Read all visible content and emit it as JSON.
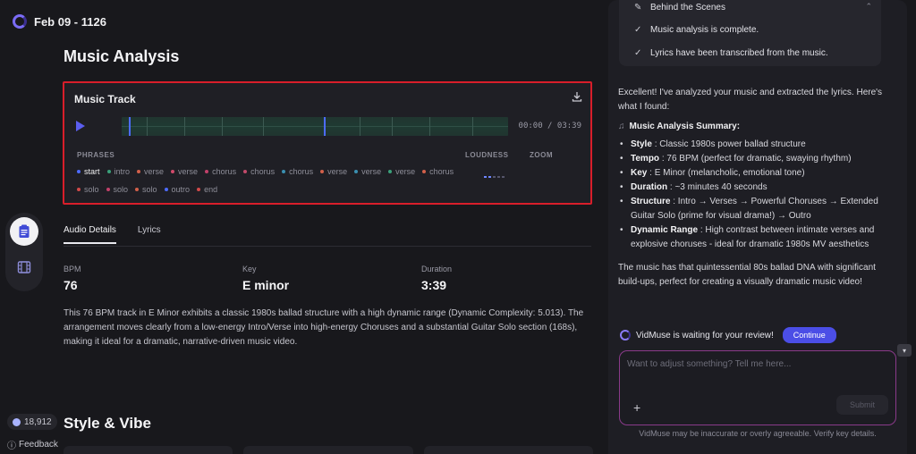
{
  "header": {
    "title": "Feb 09 - 1126"
  },
  "rail": {
    "credits": "18,912",
    "feedback": "Feedback"
  },
  "main": {
    "title": "Music Analysis",
    "track": {
      "title": "Music Track",
      "time": "00:00 / 03:39",
      "labels": {
        "phrases": "PHRASES",
        "loudness": "LOUDNESS",
        "zoom": "ZOOM"
      },
      "phrases": [
        {
          "name": "start",
          "color": "#4d6bff"
        },
        {
          "name": "intro",
          "color": "#3aa07a"
        },
        {
          "name": "verse",
          "color": "#d2604a"
        },
        {
          "name": "verse",
          "color": "#d14a6a"
        },
        {
          "name": "chorus",
          "color": "#c2416a"
        },
        {
          "name": "chorus",
          "color": "#c24a6a"
        },
        {
          "name": "chorus",
          "color": "#3a8fb0"
        },
        {
          "name": "verse",
          "color": "#d2604a"
        },
        {
          "name": "verse",
          "color": "#3a8fb0"
        },
        {
          "name": "verse",
          "color": "#3aa07a"
        },
        {
          "name": "chorus",
          "color": "#d2604a"
        },
        {
          "name": "solo",
          "color": "#d14a4a"
        },
        {
          "name": "solo",
          "color": "#c2416a"
        },
        {
          "name": "solo",
          "color": "#d2604a"
        },
        {
          "name": "outro",
          "color": "#4d6bff"
        },
        {
          "name": "end",
          "color": "#d14a4a"
        }
      ]
    },
    "tabs": [
      {
        "label": "Audio Details"
      },
      {
        "label": "Lyrics"
      }
    ],
    "stats": {
      "bpm": {
        "label": "BPM",
        "value": "76"
      },
      "key": {
        "label": "Key",
        "value": "E minor"
      },
      "duration": {
        "label": "Duration",
        "value": "3:39"
      }
    },
    "description": "This 76 BPM track in E Minor exhibits a classic 1980s ballad structure with a high dynamic range (Dynamic Complexity: 5.013). The arrangement moves clearly from a low-energy Intro/Verse into high-energy Choruses and a substantial Guitar Solo section (168s), making it ideal for a dramatic, narrative-driven music video.",
    "style_title": "Style & Vibe"
  },
  "chat": {
    "scenes": {
      "title": "Behind the Scenes",
      "items": [
        "Music analysis is complete.",
        "Lyrics have been transcribed from the music."
      ]
    },
    "intro": "Excellent! I've analyzed your music and extracted the lyrics. Here's what I found:",
    "summary_title": "Music Analysis Summary:",
    "bullets": [
      {
        "k": "Style",
        "v": ": Classic 1980s power ballad structure"
      },
      {
        "k": "Tempo",
        "v": ": 76 BPM (perfect for dramatic, swaying rhythm)"
      },
      {
        "k": "Key",
        "v": ": E Minor (melancholic, emotional tone)"
      },
      {
        "k": "Duration",
        "v": ": ~3 minutes 40 seconds"
      },
      {
        "k": "Structure",
        "v": ": Intro → Verses → Powerful Choruses → Extended Guitar Solo (prime for visual drama!) → Outro"
      },
      {
        "k": "Dynamic Range",
        "v": ": High contrast between intimate verses and explosive choruses - ideal for dramatic 1980s MV aesthetics"
      }
    ],
    "closing": "The music has that quintessential 80s ballad DNA with significant build-ups, perfect for creating a visually dramatic music video!",
    "waiting": "VidMuse is waiting for your review!",
    "continue": "Continue",
    "input_placeholder": "Want to adjust something? Tell me here...",
    "submit": "Submit",
    "disclaimer": "VidMuse may be inaccurate or overly agreeable. Verify key details."
  }
}
